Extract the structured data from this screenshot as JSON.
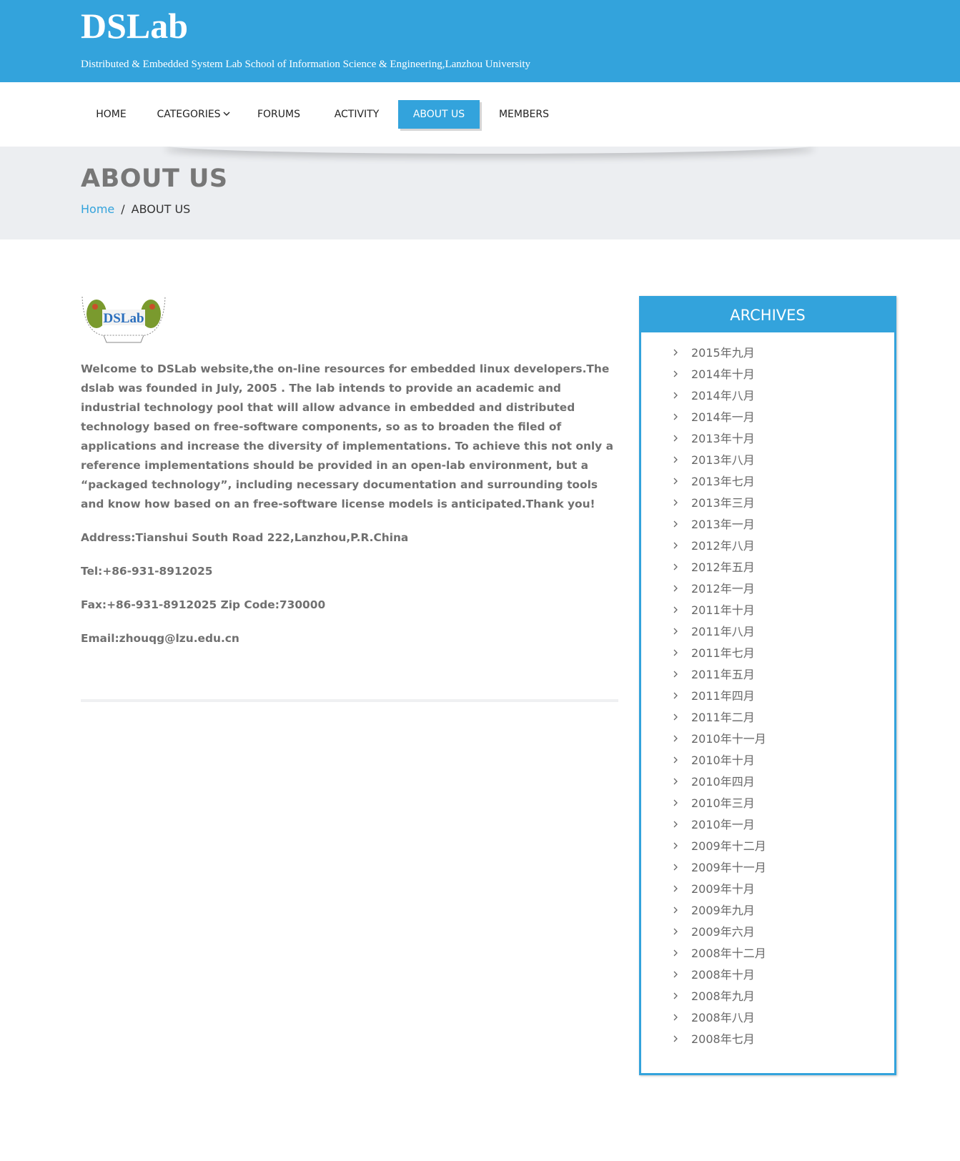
{
  "header": {
    "site_title": "DSLab",
    "site_description": "Distributed & Embedded System Lab School of Information Science & Engineering,Lanzhou University",
    "background_color": "#33a3dc"
  },
  "nav": {
    "items": [
      {
        "label": "HOME"
      },
      {
        "label": "CATEGORIES"
      },
      {
        "label": "FORUMS"
      },
      {
        "label": "ACTIVITY"
      },
      {
        "label": "ABOUT US"
      },
      {
        "label": "MEMBERS"
      }
    ],
    "active": "ABOUT US",
    "dropdown_icon": "chevron-down-icon"
  },
  "banner": {
    "page_title": "ABOUT US",
    "breadcrumb": {
      "home": "Home",
      "separator": "/",
      "current": "ABOUT US"
    }
  },
  "content": {
    "logo_text": "DSLab",
    "intro": "Welcome to DSLab website,the on-line resources for embedded linux developers.The dslab was founded in July, 2005 . The lab intends to provide an academic and industrial technology pool that will allow advance in embedded and distributed technology based on free-software components, so as to broaden the filed of applications and increase the diversity of implementations. To achieve this not only a reference implementations should be provided in an open-lab environment, but a “packaged technology”, including necessary documentation and surrounding tools and know how based on an free-software license models is anticipated.Thank you!",
    "address": "Address:Tianshui South Road 222,Lanzhou,P.R.China",
    "tel": "Tel:+86-931-8912025",
    "fax": "Fax:+86-931-8912025 Zip Code:730000",
    "email": "Email:zhouqg@lzu.edu.cn"
  },
  "sidebar": {
    "title": "ARCHIVES",
    "item_icon": "chevron-right-icon",
    "items": [
      "2015年九月",
      "2014年十月",
      "2014年八月",
      "2014年一月",
      "2013年十月",
      "2013年八月",
      "2013年七月",
      "2013年三月",
      "2013年一月",
      "2012年八月",
      "2012年五月",
      "2012年一月",
      "2011年十月",
      "2011年八月",
      "2011年七月",
      "2011年五月",
      "2011年四月",
      "2011年二月",
      "2010年十一月",
      "2010年十月",
      "2010年四月",
      "2010年三月",
      "2010年一月",
      "2009年十二月",
      "2009年十一月",
      "2009年十月",
      "2009年九月",
      "2009年六月",
      "2008年十二月",
      "2008年十月",
      "2008年九月",
      "2008年八月",
      "2008年七月"
    ]
  }
}
